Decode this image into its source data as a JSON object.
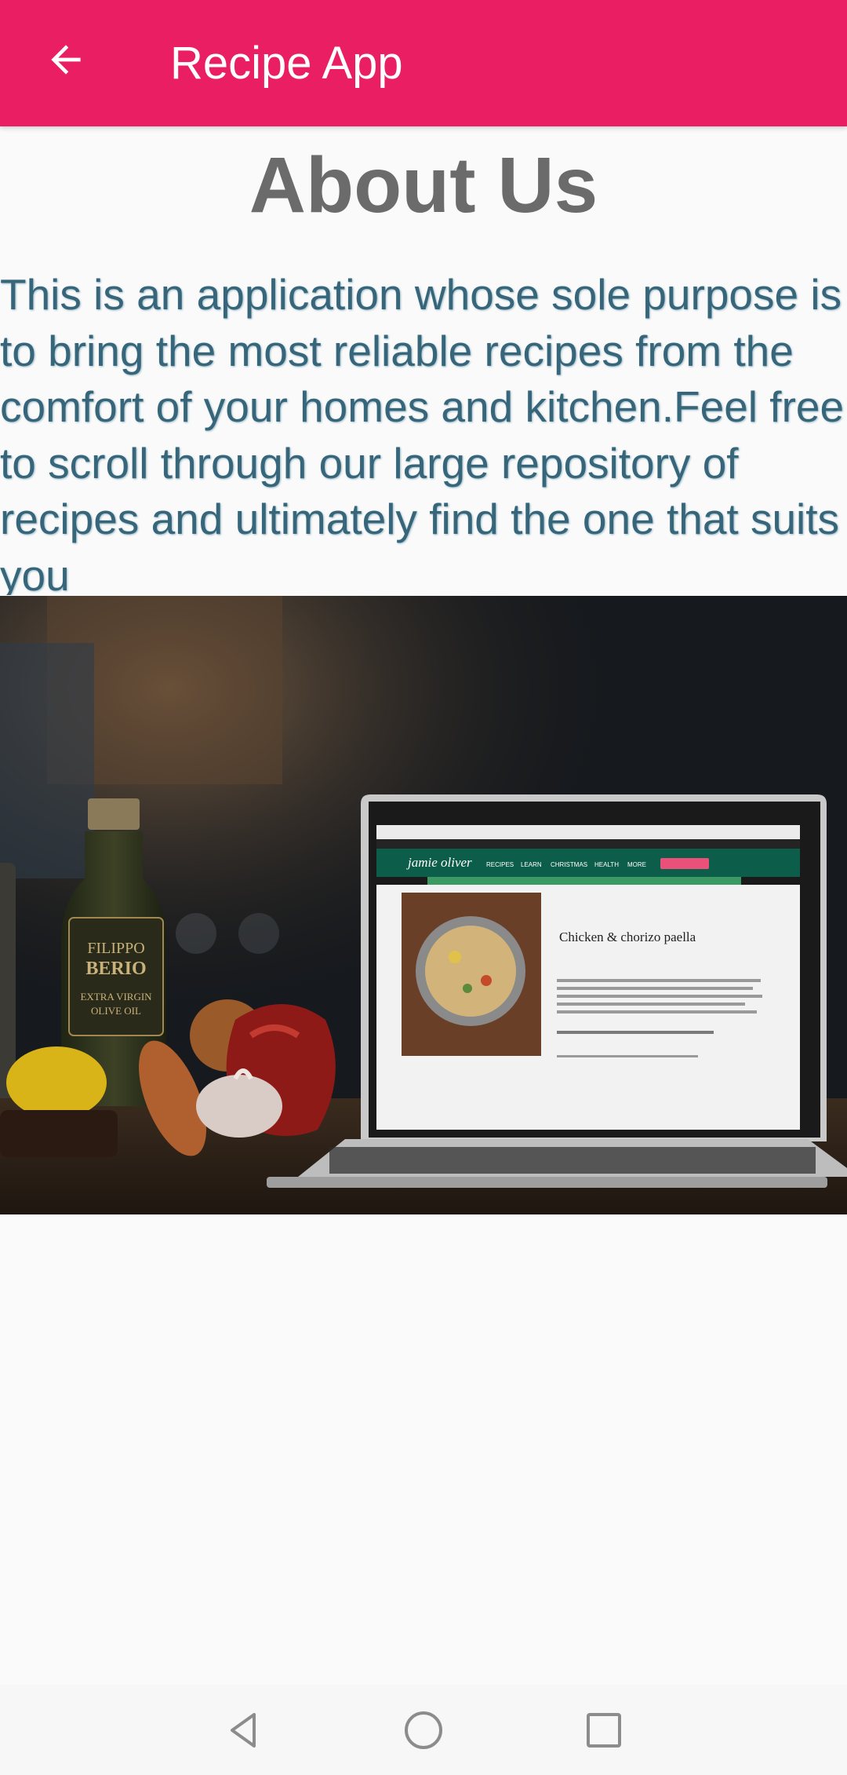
{
  "app_bar": {
    "title": "Recipe App",
    "back_icon": "arrow-back-icon",
    "background_color": "#e91e63"
  },
  "page": {
    "title": "About Us",
    "description": "This is an application whose sole purpose is to bring the most reliable recipes from the comfort of your homes and kitchen.Feel free to scroll through our large repository of recipes and ultimately find the one that suits you"
  },
  "hero_image": {
    "browser_brand": "jamie oliver",
    "nav_items": [
      "RECIPES",
      "LEARN",
      "CHRISTMAS",
      "HEALTH",
      "MORE"
    ],
    "recipe_title": "Chicken & chorizo paella",
    "bottle_label": [
      "FILIPPO",
      "BERIO",
      "EXTRA VIRGIN",
      "OLIVE OIL"
    ]
  },
  "nav_bar": {
    "back_icon": "triangle-back-icon",
    "home_icon": "circle-home-icon",
    "recents_icon": "square-recents-icon"
  }
}
